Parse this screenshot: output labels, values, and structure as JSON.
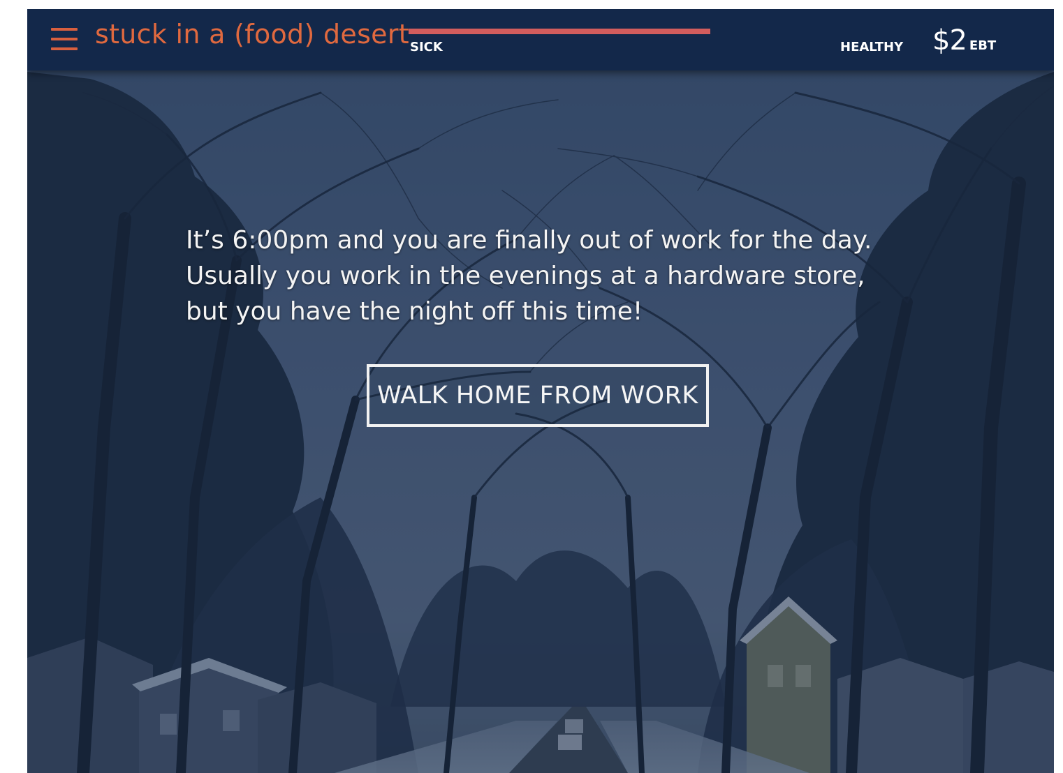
{
  "header": {
    "app_title": "stuck in a (food) desert",
    "health_meter": {
      "left_label": "SICK",
      "right_label": "HEALTHY",
      "level": 1.0,
      "fill_color": "#d35d5d"
    },
    "wallet": {
      "amount": "$2",
      "currency": "EBT"
    }
  },
  "story": {
    "lines": [
      "It’s 6:00pm and you are finally out of work for the day.",
      "Usually you work in the evenings at a hardware store,",
      "but you have the night off this time!"
    ]
  },
  "action": {
    "label": "WALK HOME FROM WORK"
  },
  "colors": {
    "header_bg": "#13284a",
    "accent": "#e0693f",
    "health_bar": "#d35d5d"
  },
  "icons": {
    "menu": "hamburger-menu-icon"
  }
}
